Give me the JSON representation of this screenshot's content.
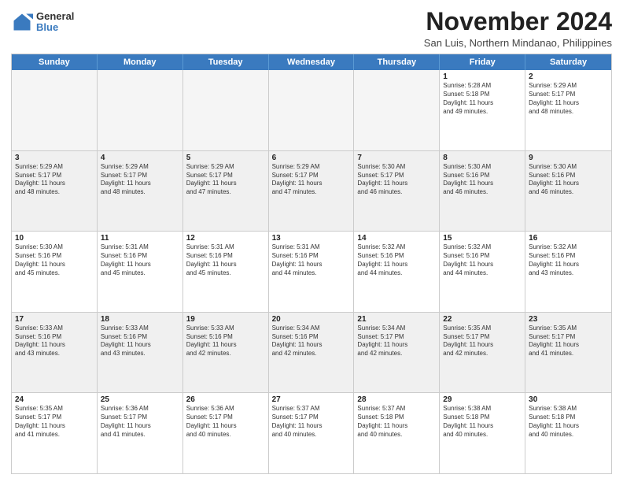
{
  "logo": {
    "general": "General",
    "blue": "Blue"
  },
  "header": {
    "month": "November 2024",
    "location": "San Luis, Northern Mindanao, Philippines"
  },
  "days_of_week": [
    "Sunday",
    "Monday",
    "Tuesday",
    "Wednesday",
    "Thursday",
    "Friday",
    "Saturday"
  ],
  "weeks": [
    [
      {
        "day": "",
        "info": "",
        "empty": true
      },
      {
        "day": "",
        "info": "",
        "empty": true
      },
      {
        "day": "",
        "info": "",
        "empty": true
      },
      {
        "day": "",
        "info": "",
        "empty": true
      },
      {
        "day": "",
        "info": "",
        "empty": true
      },
      {
        "day": "1",
        "info": "Sunrise: 5:28 AM\nSunset: 5:18 PM\nDaylight: 11 hours\nand 49 minutes.",
        "empty": false
      },
      {
        "day": "2",
        "info": "Sunrise: 5:29 AM\nSunset: 5:17 PM\nDaylight: 11 hours\nand 48 minutes.",
        "empty": false
      }
    ],
    [
      {
        "day": "3",
        "info": "Sunrise: 5:29 AM\nSunset: 5:17 PM\nDaylight: 11 hours\nand 48 minutes.",
        "empty": false
      },
      {
        "day": "4",
        "info": "Sunrise: 5:29 AM\nSunset: 5:17 PM\nDaylight: 11 hours\nand 48 minutes.",
        "empty": false
      },
      {
        "day": "5",
        "info": "Sunrise: 5:29 AM\nSunset: 5:17 PM\nDaylight: 11 hours\nand 47 minutes.",
        "empty": false
      },
      {
        "day": "6",
        "info": "Sunrise: 5:29 AM\nSunset: 5:17 PM\nDaylight: 11 hours\nand 47 minutes.",
        "empty": false
      },
      {
        "day": "7",
        "info": "Sunrise: 5:30 AM\nSunset: 5:17 PM\nDaylight: 11 hours\nand 46 minutes.",
        "empty": false
      },
      {
        "day": "8",
        "info": "Sunrise: 5:30 AM\nSunset: 5:16 PM\nDaylight: 11 hours\nand 46 minutes.",
        "empty": false
      },
      {
        "day": "9",
        "info": "Sunrise: 5:30 AM\nSunset: 5:16 PM\nDaylight: 11 hours\nand 46 minutes.",
        "empty": false
      }
    ],
    [
      {
        "day": "10",
        "info": "Sunrise: 5:30 AM\nSunset: 5:16 PM\nDaylight: 11 hours\nand 45 minutes.",
        "empty": false
      },
      {
        "day": "11",
        "info": "Sunrise: 5:31 AM\nSunset: 5:16 PM\nDaylight: 11 hours\nand 45 minutes.",
        "empty": false
      },
      {
        "day": "12",
        "info": "Sunrise: 5:31 AM\nSunset: 5:16 PM\nDaylight: 11 hours\nand 45 minutes.",
        "empty": false
      },
      {
        "day": "13",
        "info": "Sunrise: 5:31 AM\nSunset: 5:16 PM\nDaylight: 11 hours\nand 44 minutes.",
        "empty": false
      },
      {
        "day": "14",
        "info": "Sunrise: 5:32 AM\nSunset: 5:16 PM\nDaylight: 11 hours\nand 44 minutes.",
        "empty": false
      },
      {
        "day": "15",
        "info": "Sunrise: 5:32 AM\nSunset: 5:16 PM\nDaylight: 11 hours\nand 44 minutes.",
        "empty": false
      },
      {
        "day": "16",
        "info": "Sunrise: 5:32 AM\nSunset: 5:16 PM\nDaylight: 11 hours\nand 43 minutes.",
        "empty": false
      }
    ],
    [
      {
        "day": "17",
        "info": "Sunrise: 5:33 AM\nSunset: 5:16 PM\nDaylight: 11 hours\nand 43 minutes.",
        "empty": false
      },
      {
        "day": "18",
        "info": "Sunrise: 5:33 AM\nSunset: 5:16 PM\nDaylight: 11 hours\nand 43 minutes.",
        "empty": false
      },
      {
        "day": "19",
        "info": "Sunrise: 5:33 AM\nSunset: 5:16 PM\nDaylight: 11 hours\nand 42 minutes.",
        "empty": false
      },
      {
        "day": "20",
        "info": "Sunrise: 5:34 AM\nSunset: 5:16 PM\nDaylight: 11 hours\nand 42 minutes.",
        "empty": false
      },
      {
        "day": "21",
        "info": "Sunrise: 5:34 AM\nSunset: 5:17 PM\nDaylight: 11 hours\nand 42 minutes.",
        "empty": false
      },
      {
        "day": "22",
        "info": "Sunrise: 5:35 AM\nSunset: 5:17 PM\nDaylight: 11 hours\nand 42 minutes.",
        "empty": false
      },
      {
        "day": "23",
        "info": "Sunrise: 5:35 AM\nSunset: 5:17 PM\nDaylight: 11 hours\nand 41 minutes.",
        "empty": false
      }
    ],
    [
      {
        "day": "24",
        "info": "Sunrise: 5:35 AM\nSunset: 5:17 PM\nDaylight: 11 hours\nand 41 minutes.",
        "empty": false
      },
      {
        "day": "25",
        "info": "Sunrise: 5:36 AM\nSunset: 5:17 PM\nDaylight: 11 hours\nand 41 minutes.",
        "empty": false
      },
      {
        "day": "26",
        "info": "Sunrise: 5:36 AM\nSunset: 5:17 PM\nDaylight: 11 hours\nand 40 minutes.",
        "empty": false
      },
      {
        "day": "27",
        "info": "Sunrise: 5:37 AM\nSunset: 5:17 PM\nDaylight: 11 hours\nand 40 minutes.",
        "empty": false
      },
      {
        "day": "28",
        "info": "Sunrise: 5:37 AM\nSunset: 5:18 PM\nDaylight: 11 hours\nand 40 minutes.",
        "empty": false
      },
      {
        "day": "29",
        "info": "Sunrise: 5:38 AM\nSunset: 5:18 PM\nDaylight: 11 hours\nand 40 minutes.",
        "empty": false
      },
      {
        "day": "30",
        "info": "Sunrise: 5:38 AM\nSunset: 5:18 PM\nDaylight: 11 hours\nand 40 minutes.",
        "empty": false
      }
    ]
  ]
}
